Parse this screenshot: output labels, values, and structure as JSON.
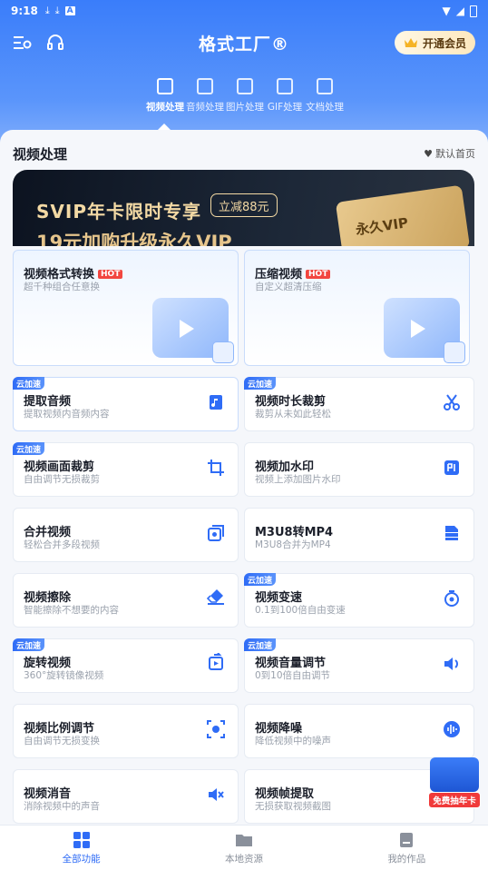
{
  "status_bar": {
    "time": "9:18",
    "icons": [
      "download-icon",
      "download-icon",
      "a-icon"
    ]
  },
  "nav": {
    "title": "格式工厂®",
    "vip_label": "开通会员"
  },
  "tabs": [
    {
      "label": "视频处理",
      "active": true
    },
    {
      "label": "音频处理",
      "active": false
    },
    {
      "label": "图片处理",
      "active": false
    },
    {
      "label": "GIF处理",
      "active": false
    },
    {
      "label": "文档处理",
      "active": false
    }
  ],
  "section": {
    "title": "视频处理",
    "default_home": "默认首页"
  },
  "banner": {
    "title": "SVIP年卡限时专享",
    "badge": "立减88元",
    "subtitle": "19元加购升级永久VIP",
    "card_text": "永久VIP"
  },
  "features": {
    "video_convert": {
      "title": "视频格式转换",
      "hot": "HOT",
      "sub": "超千种组合任意换"
    },
    "compress": {
      "title": "压缩视频",
      "hot": "HOT",
      "sub": "自定义超清压缩"
    },
    "extract_audio": {
      "title": "提取音频",
      "sub": "提取视频内音频内容",
      "cloud": "云加速"
    },
    "trim": {
      "title": "视频时长裁剪",
      "sub": "裁剪从未如此轻松",
      "cloud": "云加速"
    },
    "crop": {
      "title": "视频画面裁剪",
      "sub": "自由调节无损裁剪",
      "cloud": "云加速"
    },
    "watermark": {
      "title": "视频加水印",
      "sub": "视频上添加图片水印"
    },
    "merge": {
      "title": "合并视频",
      "sub": "轻松合并多段视频"
    },
    "m3u8": {
      "title": "M3U8转MP4",
      "sub": "M3U8合并为MP4"
    },
    "erase": {
      "title": "视频擦除",
      "sub": "智能擦除不想要的内容"
    },
    "speed": {
      "title": "视频变速",
      "sub": "0.1到100倍自由变速",
      "cloud": "云加速"
    },
    "rotate": {
      "title": "旋转视频",
      "sub": "360°旋转镜像视频",
      "cloud": "云加速"
    },
    "volume": {
      "title": "视频音量调节",
      "sub": "0到10倍自由调节",
      "cloud": "云加速"
    },
    "ratio": {
      "title": "视频比例调节",
      "sub": "自由调节无损变换"
    },
    "denoise": {
      "title": "视频降噪",
      "sub": "降低视频中的噪声"
    },
    "mute": {
      "title": "视频消音",
      "sub": "消除视频中的声音"
    },
    "frame": {
      "title": "视频帧提取",
      "sub": "无损获取视频截图"
    }
  },
  "promo": {
    "label": "免费抽年卡"
  },
  "bottom_nav": [
    {
      "label": "全部功能",
      "active": true
    },
    {
      "label": "本地资源",
      "active": false
    },
    {
      "label": "我的作品",
      "active": false
    }
  ],
  "colors": {
    "accent": "#2f6cf6",
    "hot": "#f2463f",
    "header": "#3a7dfa"
  }
}
